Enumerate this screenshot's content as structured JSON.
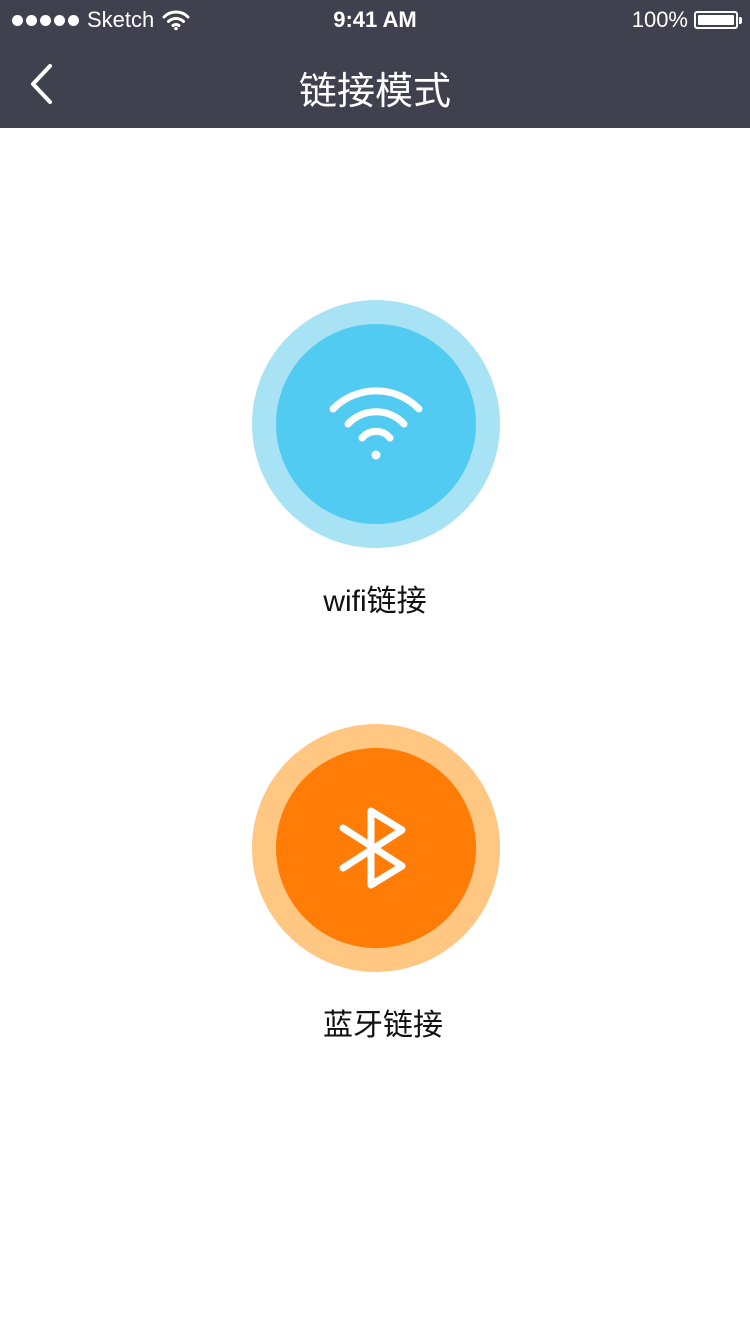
{
  "status_bar": {
    "carrier": "Sketch",
    "time": "9:41 AM",
    "battery": "100%"
  },
  "nav": {
    "title": "链接模式",
    "back_icon": "chevron-left-icon"
  },
  "options": [
    {
      "label": "wifi链接",
      "icon": "wifi-icon",
      "outer_color": "#a8e3f5",
      "inner_color": "#52cbf3"
    },
    {
      "label": "蓝牙链接",
      "icon": "bluetooth-icon",
      "outer_color": "#ffc782",
      "inner_color": "#ff7c06"
    }
  ],
  "colors": {
    "topbar": "#40414e",
    "background": "#ffffff"
  }
}
